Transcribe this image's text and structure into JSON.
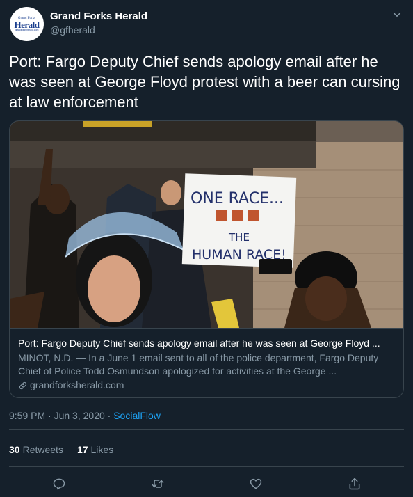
{
  "account": {
    "display_name": "Grand Forks Herald",
    "handle": "@gfherald",
    "avatar_text_top": "Grand Forks",
    "avatar_text_main": "Herald",
    "avatar_text_bottom": "grandforksherald.com"
  },
  "tweet": {
    "text": "Port: Fargo Deputy Chief sends apology email after he was seen at George Floyd protest with a beer can cursing at law enforcement"
  },
  "card": {
    "image_sign_line1": "ONE RACE...",
    "image_sign_line2": "THE",
    "image_sign_line3": "HUMAN RACE!",
    "title": "Port: Fargo Deputy Chief sends apology email after he was seen at George Floyd ...",
    "description": "MINOT, N.D. — In a June 1 email sent to all of the police department, Fargo Deputy Chief of Police Todd Osmundson apologized for activities at the George ...",
    "domain": "grandforksherald.com"
  },
  "meta": {
    "time": "9:59 PM",
    "separator": "·",
    "date": "Jun 3, 2020",
    "source": "SocialFlow"
  },
  "stats": {
    "retweets_count": "30",
    "retweets_label": "Retweets",
    "likes_count": "17",
    "likes_label": "Likes"
  },
  "icons": {
    "caret": "chevron-down-icon",
    "link": "link-icon",
    "reply": "reply-icon",
    "retweet": "retweet-icon",
    "like": "heart-icon",
    "share": "share-icon"
  },
  "colors": {
    "background": "#15202b",
    "border": "#38444d",
    "secondary_text": "#8899a6",
    "accent": "#1da1f2"
  }
}
